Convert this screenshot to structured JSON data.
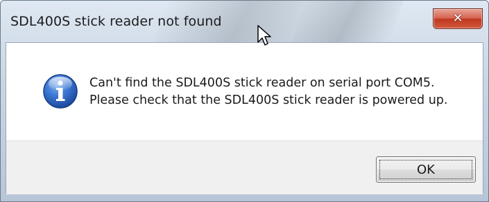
{
  "window": {
    "title": "SDL400S stick reader not found",
    "close_glyph": "✕"
  },
  "message": {
    "icon": "info-icon",
    "line1": "Can't find the SDL400S stick reader on serial port COM5.",
    "line2": "Please check that the SDL400S stick reader is powered up."
  },
  "buttons": {
    "ok_label": "OK"
  },
  "colors": {
    "info_icon_blue": "#2a64c5",
    "close_button_red": "#c7452c"
  }
}
